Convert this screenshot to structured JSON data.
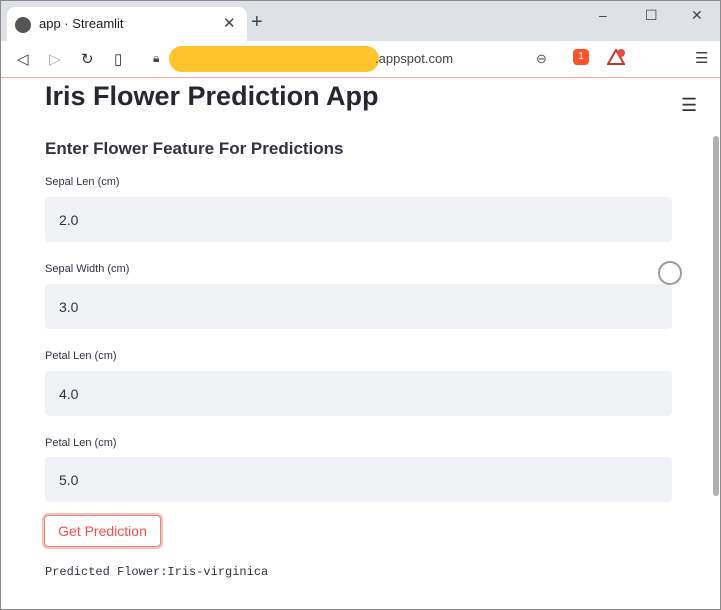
{
  "browser": {
    "tab_title": "app · Streamlit",
    "tab_close": "✕",
    "new_tab": "+",
    "url": ".appspot.com",
    "window_controls": [
      "–",
      "☐",
      "✕"
    ],
    "extension_badges": {
      "shield_count": "1",
      "warning_count": "1"
    }
  },
  "app": {
    "title": "Iris Flower Prediction App",
    "subheading": "Enter Flower Feature For Predictions",
    "fields": [
      {
        "label": "Sepal Len (cm)",
        "value": "2.0"
      },
      {
        "label": "Sepal Width (cm)",
        "value": "3.0"
      },
      {
        "label": "Petal Len (cm)",
        "value": "4.0"
      },
      {
        "label": "Petal Len (cm)",
        "value": "5.0"
      }
    ],
    "button_label": "Get Prediction",
    "result_text": "Predicted Flower:Iris-virginica"
  },
  "colors": {
    "accent": "#ff4b4b",
    "input_bg": "#f0f2f6",
    "redaction": "#ffc32b"
  }
}
